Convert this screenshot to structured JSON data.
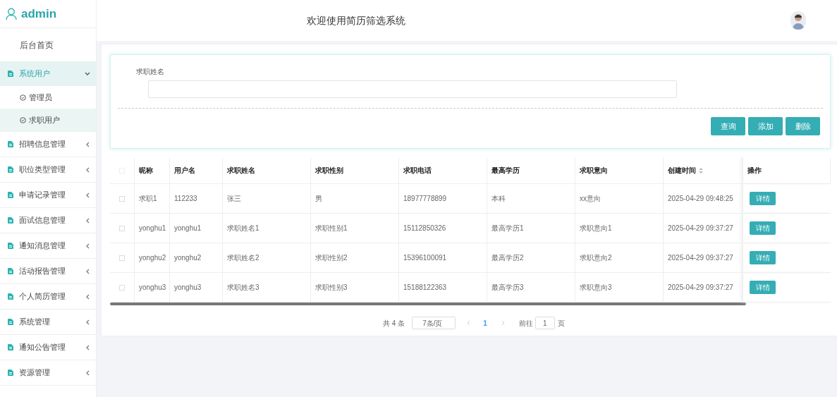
{
  "sidebar": {
    "user": "admin",
    "items": [
      {
        "kind": "link",
        "label": "后台首页"
      },
      {
        "kind": "group",
        "label": "系统用户",
        "expanded": true,
        "children": [
          {
            "label": "管理员",
            "selected": false
          },
          {
            "label": "求职用户",
            "selected": true
          }
        ]
      },
      {
        "kind": "group",
        "label": "招聘信息管理",
        "expanded": false
      },
      {
        "kind": "group",
        "label": "职位类型管理",
        "expanded": false
      },
      {
        "kind": "group",
        "label": "申请记录管理",
        "expanded": false
      },
      {
        "kind": "group",
        "label": "面试信息管理",
        "expanded": false
      },
      {
        "kind": "group",
        "label": "通知消息管理",
        "expanded": false
      },
      {
        "kind": "group",
        "label": "活动报告管理",
        "expanded": false
      },
      {
        "kind": "group",
        "label": "个人简历管理",
        "expanded": false
      },
      {
        "kind": "group",
        "label": "系统管理",
        "expanded": false
      },
      {
        "kind": "group",
        "label": "通知公告管理",
        "expanded": false
      },
      {
        "kind": "group",
        "label": "资源管理",
        "expanded": false
      }
    ]
  },
  "header": {
    "title": "欢迎使用简历筛选系统"
  },
  "search": {
    "label": "求职姓名",
    "buttons": [
      "查询",
      "添加",
      "删除"
    ]
  },
  "table": {
    "all_checked": false,
    "columns": [
      {
        "label": "昵称"
      },
      {
        "label": "用户名"
      },
      {
        "label": "求职姓名"
      },
      {
        "label": "求职性别"
      },
      {
        "label": "求职电话"
      },
      {
        "label": "最高学历"
      },
      {
        "label": "求职意向"
      },
      {
        "label": "创建时间",
        "sortable": true
      },
      {
        "label": "操作"
      }
    ],
    "rows": [
      {
        "checked": false,
        "cells": [
          "求职1",
          "112233",
          "张三",
          "男",
          "18977778899",
          "本科",
          "xx意向",
          "2025-04-29 09:48:25"
        ],
        "action": "详情"
      },
      {
        "checked": false,
        "cells": [
          "yonghu1",
          "yonghu1",
          "求职姓名1",
          "求职性别1",
          "15112850326",
          "最高学历1",
          "求职意向1",
          "2025-04-29 09:37:27"
        ],
        "action": "详情"
      },
      {
        "checked": false,
        "cells": [
          "yonghu2",
          "yonghu2",
          "求职姓名2",
          "求职性别2",
          "15396100091",
          "最高学历2",
          "求职意向2",
          "2025-04-29 09:37:27"
        ],
        "action": "详情"
      },
      {
        "checked": false,
        "cells": [
          "yonghu3",
          "yonghu3",
          "求职姓名3",
          "求职性别3",
          "15188122363",
          "最高学历3",
          "求职意向3",
          "2025-04-29 09:37:27"
        ],
        "action": "详情"
      }
    ]
  },
  "pagination": {
    "total": "共 4 条",
    "page_size": "7条/页",
    "pages": [
      {
        "label": "1",
        "selected": true
      }
    ],
    "goto_label": "前往",
    "goto_value": "1",
    "goto_suffix": "页"
  }
}
